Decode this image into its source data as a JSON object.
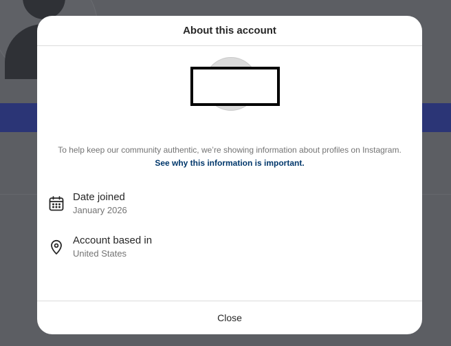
{
  "modal": {
    "title": "About this account",
    "disclaimer_text": "To help keep our community authentic, we’re showing information about profiles on Instagram.",
    "disclaimer_link": "See why this information is important.",
    "rows": [
      {
        "icon": "calendar-icon",
        "label": "Date joined",
        "value": "January 2026"
      },
      {
        "icon": "location-pin-icon",
        "label": "Account based in",
        "value": "United States"
      }
    ],
    "close_label": "Close"
  },
  "colors": {
    "overlay": "#5c5e63",
    "background_bar": "#2b3576",
    "link": "#00376b",
    "text_primary": "#262626",
    "text_secondary": "#737373",
    "divider": "#dbdbdb"
  }
}
